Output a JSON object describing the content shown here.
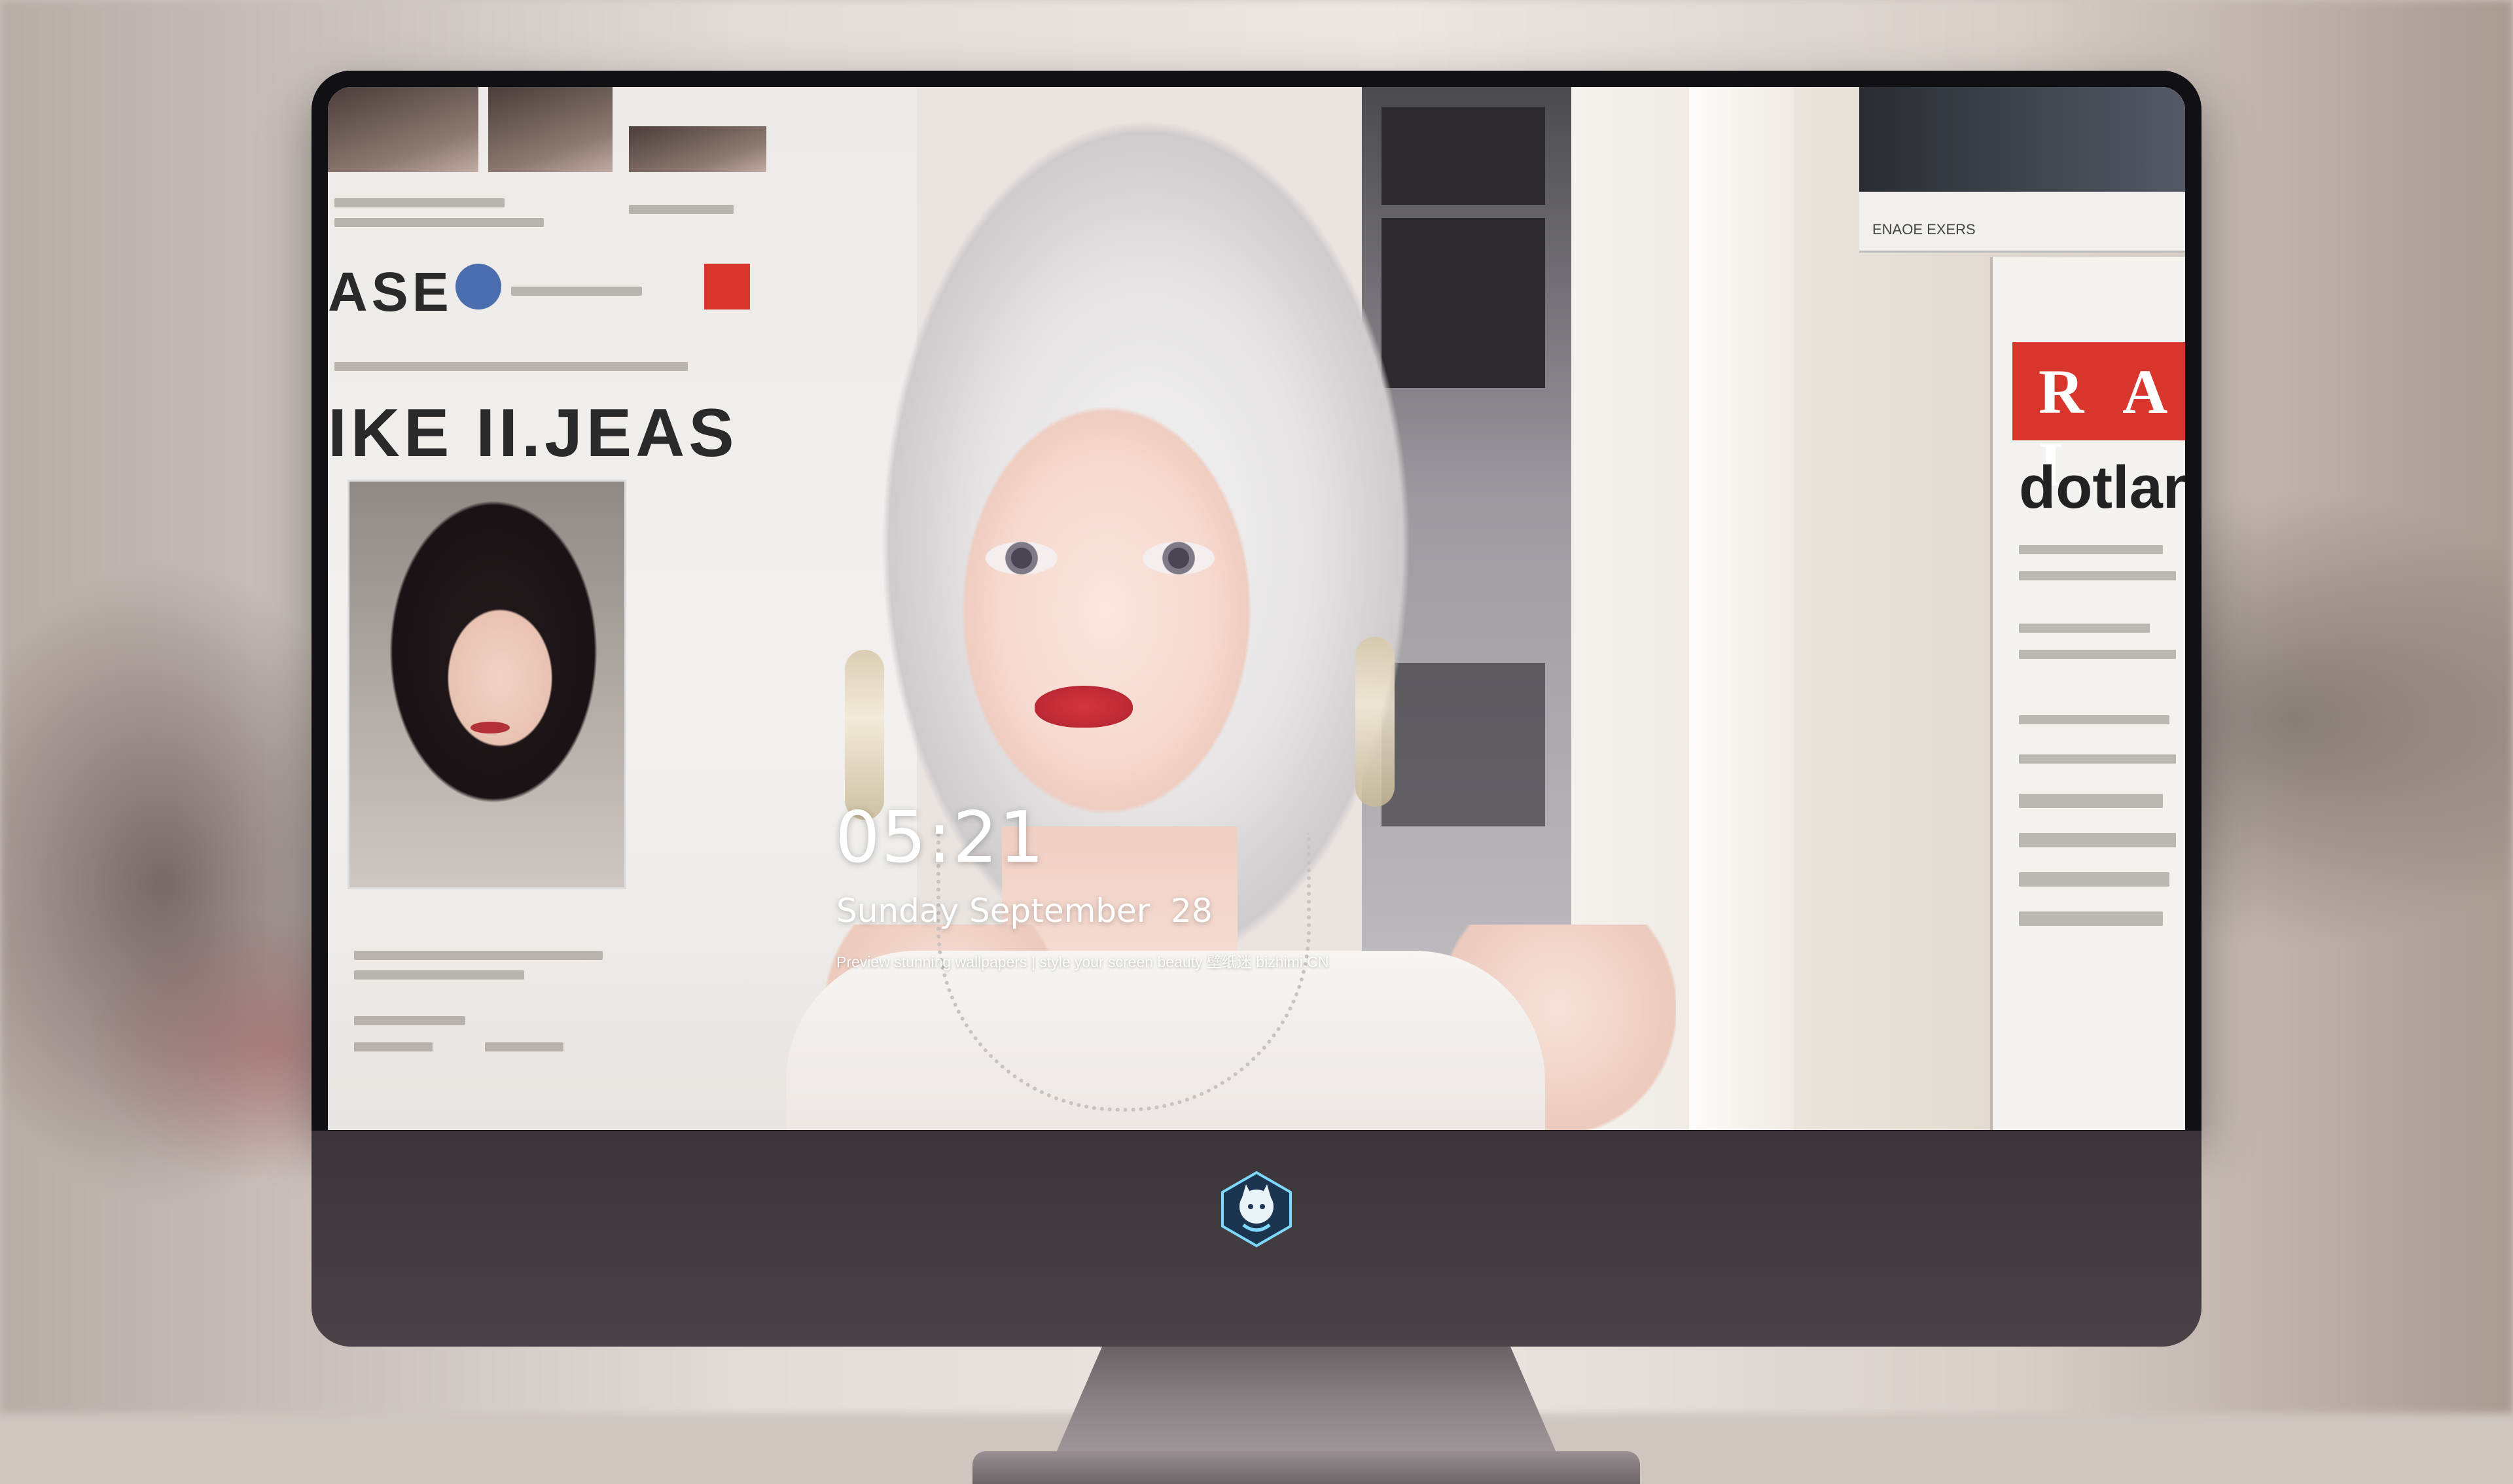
{
  "lockscreen": {
    "time": "05:21",
    "date": "Sunday September  28",
    "tagline": "Preview stunning wallpapers | style your screen beauty  壁纸迷  bizhimi.CN"
  },
  "wallpaper_text": {
    "left_headline_1": "ASE",
    "left_headline_2": "IKE II.JEAS",
    "right_red": "R A I",
    "right_big": "dotlan",
    "top_caption": "ENAOE EXERS"
  },
  "dock": {
    "apps": [
      {
        "icon": "messages-icon"
      },
      {
        "icon": "weather-icon"
      },
      {
        "icon": "clock-icon"
      },
      {
        "icon": "preview-icon"
      },
      {
        "icon": "clips-icon"
      },
      {
        "icon": "notes-icon"
      },
      {
        "icon": "photo-booth-icon"
      },
      {
        "icon": "music-icon"
      },
      {
        "icon": "app-store-icon"
      },
      {
        "icon": "camera-icon"
      }
    ]
  },
  "colors": {
    "bezel": "#111014",
    "chin": "#3f383c",
    "text": "#ffffff"
  }
}
